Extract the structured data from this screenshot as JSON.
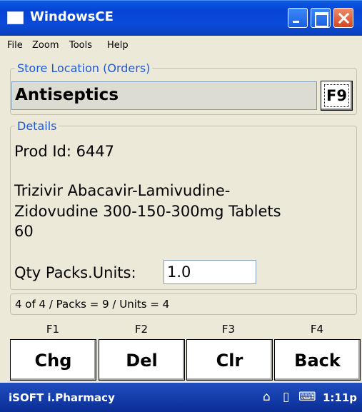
{
  "window": {
    "title": "WindowsCE"
  },
  "menu": {
    "items": [
      {
        "label": "File"
      },
      {
        "label": "Zoom"
      },
      {
        "label": "Tools"
      },
      {
        "label": "Help"
      }
    ]
  },
  "store": {
    "group_label": "Store Location (Orders)",
    "value": "Antiseptics",
    "lookup_key": "F9"
  },
  "details": {
    "group_label": "Details",
    "prod_id_label": "Prod Id: 6447",
    "product_line1": "Trizivir Abacavir-Lamivudine-",
    "product_line2": "Zidovudine 300-150-300mg Tablets",
    "product_line3": "60",
    "qty_label": "Qty Packs.Units:",
    "qty_value": "1.0"
  },
  "status": {
    "text": "4 of 4 / Packs = 9 / Units = 4"
  },
  "actions": [
    {
      "key": "F1",
      "label": "Chg"
    },
    {
      "key": "F2",
      "label": "Del"
    },
    {
      "key": "F3",
      "label": "Clr"
    },
    {
      "key": "F4",
      "label": "Back"
    }
  ],
  "taskbar": {
    "app_name": "iSOFT i.Pharmacy",
    "clock": "1:11p",
    "icons": [
      "home-icon",
      "battery-icon",
      "keyboard-icon"
    ]
  },
  "colors": {
    "title_bar": "#0a4bd8",
    "group_label": "#1f58d8",
    "window_bg": "#ece9d8",
    "taskbar": "#0b2d96",
    "close_button": "#d6451d"
  }
}
